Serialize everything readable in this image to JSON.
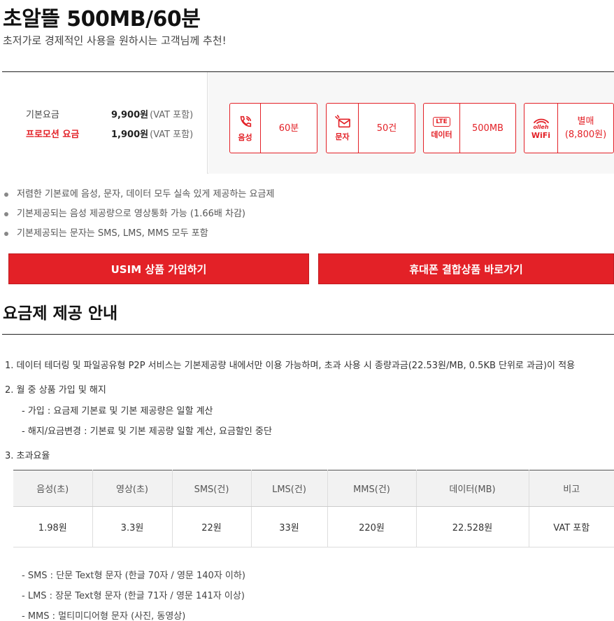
{
  "plan": {
    "title": "초알뜰 500MB/60분",
    "subtitle": "초저가로 경제적인 사용을 원하시는 고객님께 추천!"
  },
  "pricing": {
    "base_label": "기본요금",
    "base_amount": "9,900원",
    "base_note": "(VAT 포함)",
    "promo_label": "프로모션 요금",
    "promo_amount": "1,900원",
    "promo_note": "(VAT 포함)"
  },
  "features": {
    "voice": {
      "icon": "phone-icon",
      "caption": "음성",
      "value": "60분"
    },
    "sms": {
      "icon": "message-icon",
      "caption": "문자",
      "value": "50건"
    },
    "data": {
      "icon": "lte-icon",
      "badge": "LTE",
      "caption": "데이터",
      "value": "500MB"
    },
    "wifi": {
      "icon": "wifi-icon",
      "brand": "olleh",
      "caption": "WiFi",
      "value_line1": "별매",
      "value_line2": "(8,800원)"
    }
  },
  "bullets": [
    "저렴한 기본료에 음성, 문자, 데이터 모두 실속 있게 제공하는 요금제",
    "기본제공되는 음성 제공량으로 영상통화 가능 (1.66배 차감)",
    "기본제공되는 문자는 SMS, LMS, MMS 모두 포함"
  ],
  "buttons": {
    "usim": "USIM 상품 가입하기",
    "bundle": "휴대폰 결합상품 바로가기"
  },
  "guide": {
    "title": "요금제 제공 안내",
    "item1": "1. 데이터 테더링 및 파일공유형 P2P 서비스는 기본제공량 내에서만 이용 가능하며, 초과 사용 시 종량과금(22.53원/MB, 0.5KB 단위로 과금)이 적용",
    "item2": "2. 월 중 상품 가입 및 해지",
    "item2_sub1": "- 가입 : 요금제 기본료 및 기본 제공량은 일할 계산",
    "item2_sub2": "- 해지/요금변경 : 기본료 및 기본 제공량 일할 계산, 요금할인 중단",
    "item3": "3. 초과요율"
  },
  "rates_table": {
    "headers": [
      "음성(초)",
      "영상(초)",
      "SMS(건)",
      "LMS(건)",
      "MMS(건)",
      "데이터(MB)",
      "비고"
    ],
    "row": [
      "1.98원",
      "3.3원",
      "22원",
      "33원",
      "220원",
      "22.528원",
      "VAT 포함"
    ]
  },
  "footnotes": [
    "- SMS : 단문 Text형 문자 (한글 70자 / 영문 140자 이하)",
    "- LMS : 장문 Text형 문자 (한글 71자 / 영문 141자 이상)",
    "- MMS : 멀티미디어형 문자 (사진, 동영상)"
  ],
  "colors": {
    "accent": "#e32127"
  }
}
